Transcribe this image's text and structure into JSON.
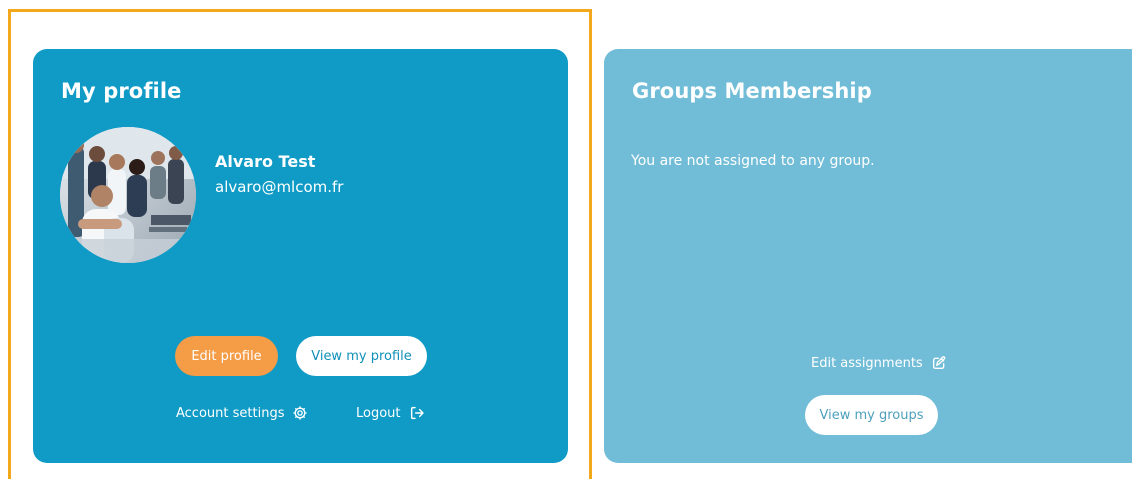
{
  "profile_card": {
    "title": "My profile",
    "user_name": "Alvaro Test",
    "user_email": "alvaro@mlcom.fr",
    "avatar_icon": "profile-photo",
    "edit_label": "Edit profile",
    "view_label": "View my profile",
    "account_settings_label": "Account settings",
    "account_settings_icon": "gear-icon",
    "logout_label": "Logout",
    "logout_icon": "sign-out-icon"
  },
  "groups_card": {
    "title": "Groups Membership",
    "empty_message": "You are not assigned to any group.",
    "edit_assignments_label": "Edit assignments",
    "edit_assignments_icon": "edit-icon",
    "view_groups_label": "View my groups"
  },
  "colors": {
    "focus_outline": "#f4a81c",
    "profile_card_bg": "#0f9bc6",
    "groups_card_bg": "#71bdd7",
    "edit_button_bg": "#f49c46",
    "white_button_bg": "#ffffff",
    "text_on_card": "#ffffff"
  }
}
